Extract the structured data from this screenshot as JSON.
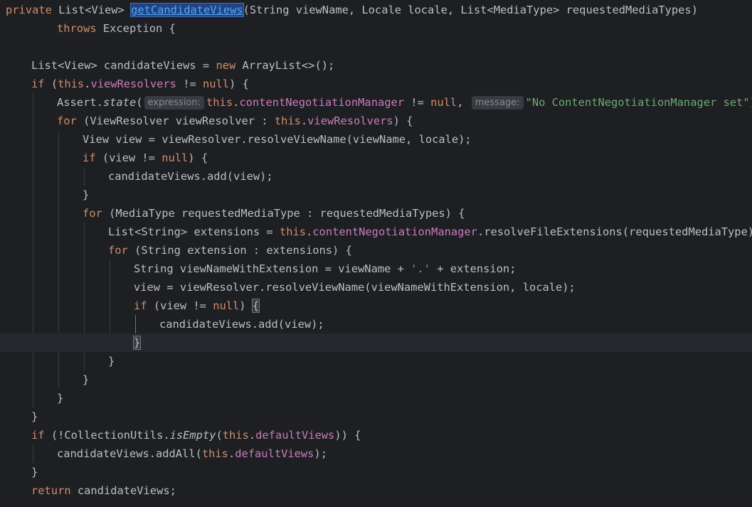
{
  "editor": {
    "lines": [
      {
        "indent": 0,
        "tokens": [
          {
            "t": "private ",
            "k": "kw"
          },
          {
            "t": "List<View> ",
            "k": "plain"
          },
          {
            "t": "getCandidateViews",
            "k": "hl",
            "name": "method-name-highlight"
          },
          {
            "t": "(String viewName, Locale locale, List<MediaType> requestedMediaTypes)",
            "k": "plain"
          }
        ]
      },
      {
        "indent": 2,
        "tokens": [
          {
            "t": "throws ",
            "k": "kw"
          },
          {
            "t": "Exception {",
            "k": "plain"
          }
        ]
      },
      {
        "indent": 0,
        "tokens": []
      },
      {
        "indent": 1,
        "tokens": [
          {
            "t": "List<View> candidateViews = ",
            "k": "plain"
          },
          {
            "t": "new ",
            "k": "kw"
          },
          {
            "t": "ArrayList<>();",
            "k": "plain"
          }
        ]
      },
      {
        "indent": 1,
        "tokens": [
          {
            "t": "if ",
            "k": "kw"
          },
          {
            "t": "(",
            "k": "plain"
          },
          {
            "t": "this",
            "k": "kw"
          },
          {
            "t": ".",
            "k": "plain"
          },
          {
            "t": "viewResolvers",
            "k": "field"
          },
          {
            "t": " != ",
            "k": "plain"
          },
          {
            "t": "null",
            "k": "kw"
          },
          {
            "t": ") {",
            "k": "plain"
          }
        ]
      },
      {
        "indent": 2,
        "tokens": [
          {
            "t": "Assert.",
            "k": "plain"
          },
          {
            "t": "state",
            "k": "static"
          },
          {
            "t": "(",
            "k": "plain"
          },
          {
            "t": "expression:",
            "k": "hint",
            "name": "parameter-hint-expression"
          },
          {
            "t": "this",
            "k": "kw"
          },
          {
            "t": ".",
            "k": "plain"
          },
          {
            "t": "contentNegotiationManager",
            "k": "field"
          },
          {
            "t": " != ",
            "k": "plain"
          },
          {
            "t": "null",
            "k": "kw"
          },
          {
            "t": ", ",
            "k": "plain"
          },
          {
            "t": "message:",
            "k": "hint",
            "name": "parameter-hint-message"
          },
          {
            "t": "\"No ContentNegotiationManager set\"",
            "k": "str"
          },
          {
            "t": ");",
            "k": "plain"
          }
        ]
      },
      {
        "indent": 2,
        "tokens": [
          {
            "t": "for ",
            "k": "kw"
          },
          {
            "t": "(ViewResolver viewResolver : ",
            "k": "plain"
          },
          {
            "t": "this",
            "k": "kw"
          },
          {
            "t": ".",
            "k": "plain"
          },
          {
            "t": "viewResolvers",
            "k": "field"
          },
          {
            "t": ") {",
            "k": "plain"
          }
        ]
      },
      {
        "indent": 3,
        "tokens": [
          {
            "t": "View view = viewResolver.resolveViewName(viewName, locale);",
            "k": "plain"
          }
        ]
      },
      {
        "indent": 3,
        "tokens": [
          {
            "t": "if ",
            "k": "kw"
          },
          {
            "t": "(view != ",
            "k": "plain"
          },
          {
            "t": "null",
            "k": "kw"
          },
          {
            "t": ") {",
            "k": "plain"
          }
        ]
      },
      {
        "indent": 4,
        "tokens": [
          {
            "t": "candidateViews.add(view);",
            "k": "plain"
          }
        ]
      },
      {
        "indent": 3,
        "tokens": [
          {
            "t": "}",
            "k": "plain"
          }
        ]
      },
      {
        "indent": 3,
        "tokens": [
          {
            "t": "for ",
            "k": "kw"
          },
          {
            "t": "(MediaType requestedMediaType : requestedMediaTypes) {",
            "k": "plain"
          }
        ]
      },
      {
        "indent": 4,
        "tokens": [
          {
            "t": "List<String> extensions = ",
            "k": "plain"
          },
          {
            "t": "this",
            "k": "kw"
          },
          {
            "t": ".",
            "k": "plain"
          },
          {
            "t": "contentNegotiationManager",
            "k": "field"
          },
          {
            "t": ".resolveFileExtensions(requestedMediaType);",
            "k": "plain"
          }
        ]
      },
      {
        "indent": 4,
        "tokens": [
          {
            "t": "for ",
            "k": "kw"
          },
          {
            "t": "(String extension : extensions) {",
            "k": "plain"
          }
        ]
      },
      {
        "indent": 5,
        "tokens": [
          {
            "t": "String viewNameWithExtension = viewName + ",
            "k": "plain"
          },
          {
            "t": "'.'",
            "k": "str"
          },
          {
            "t": " + extension;",
            "k": "plain"
          }
        ]
      },
      {
        "indent": 5,
        "tokens": [
          {
            "t": "view = viewResolver.resolveViewName(viewNameWithExtension, locale);",
            "k": "plain"
          }
        ]
      },
      {
        "indent": 5,
        "tokens": [
          {
            "t": "if ",
            "k": "kw"
          },
          {
            "t": "(view != ",
            "k": "plain"
          },
          {
            "t": "null",
            "k": "kw"
          },
          {
            "t": ") ",
            "k": "plain"
          },
          {
            "t": "{",
            "k": "brace",
            "name": "matched-brace-open"
          }
        ]
      },
      {
        "indent": 6,
        "tokens": [
          {
            "t": "candidateViews.add(view);",
            "k": "plain"
          }
        ]
      },
      {
        "indent": 5,
        "caret": true,
        "tokens": [
          {
            "t": "}",
            "k": "brace",
            "name": "matched-brace-close"
          }
        ]
      },
      {
        "indent": 4,
        "tokens": [
          {
            "t": "}",
            "k": "plain"
          }
        ]
      },
      {
        "indent": 3,
        "tokens": [
          {
            "t": "}",
            "k": "plain"
          }
        ]
      },
      {
        "indent": 2,
        "tokens": [
          {
            "t": "}",
            "k": "plain"
          }
        ]
      },
      {
        "indent": 1,
        "tokens": [
          {
            "t": "}",
            "k": "plain"
          }
        ]
      },
      {
        "indent": 1,
        "tokens": [
          {
            "t": "if ",
            "k": "kw"
          },
          {
            "t": "(!CollectionUtils.",
            "k": "plain"
          },
          {
            "t": "isEmpty",
            "k": "static"
          },
          {
            "t": "(",
            "k": "plain"
          },
          {
            "t": "this",
            "k": "kw"
          },
          {
            "t": ".",
            "k": "plain"
          },
          {
            "t": "defaultViews",
            "k": "field"
          },
          {
            "t": ")) {",
            "k": "plain"
          }
        ]
      },
      {
        "indent": 2,
        "tokens": [
          {
            "t": "candidateViews.addAll(",
            "k": "plain"
          },
          {
            "t": "this",
            "k": "kw"
          },
          {
            "t": ".",
            "k": "plain"
          },
          {
            "t": "defaultViews",
            "k": "field"
          },
          {
            "t": ");",
            "k": "plain"
          }
        ]
      },
      {
        "indent": 1,
        "tokens": [
          {
            "t": "}",
            "k": "plain"
          }
        ]
      },
      {
        "indent": 1,
        "tokens": [
          {
            "t": "return ",
            "k": "kw"
          },
          {
            "t": "candidateViews;",
            "k": "plain"
          }
        ]
      }
    ]
  }
}
